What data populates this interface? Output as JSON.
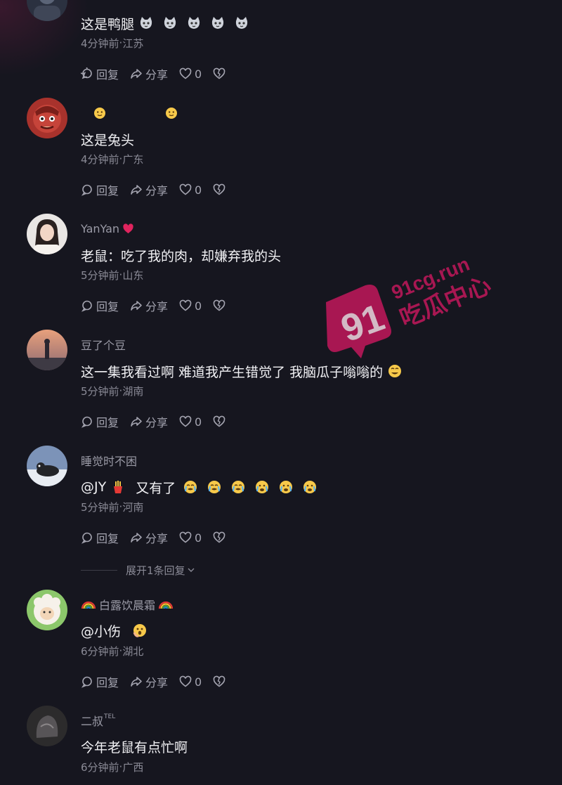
{
  "comments": [
    {
      "username": "",
      "content_text": "这是鸭腿",
      "emoji_names": [
        "cat-face-emoji",
        "cat-face-emoji",
        "cat-face-emoji",
        "cat-face-emoji",
        "cat-face-emoji"
      ],
      "time": "4分钟前",
      "location": "江苏",
      "reply_label": "回复",
      "share_label": "分享",
      "like_count": "0"
    },
    {
      "username": "",
      "content_text": "这是兔头",
      "emoji_names": [
        "slight-smile-emoji",
        "slight-smile-emoji"
      ],
      "time": "4分钟前",
      "location": "广东",
      "reply_label": "回复",
      "share_label": "分享",
      "like_count": "0"
    },
    {
      "username": "YanYan",
      "username_badge": "heart-icon",
      "content_text": "老鼠：吃了我的肉，却嫌弃我的头",
      "time": "5分钟前",
      "location": "山东",
      "reply_label": "回复",
      "share_label": "分享",
      "like_count": "0"
    },
    {
      "username": "豆了个豆",
      "content_text": "这一集我看过啊 难道我产生错觉了 我脑瓜子嗡嗡的",
      "emoji_names": [
        "dizzy-face-emoji"
      ],
      "time": "5分钟前",
      "location": "湖南",
      "reply_label": "回复",
      "share_label": "分享",
      "like_count": "0"
    },
    {
      "username": "睡觉时不困",
      "content_text": "@JY",
      "content_text_2": "又有了",
      "emoji_names": [
        "fries-emoji",
        "crying-emoji",
        "crying-emoji",
        "crying-emoji",
        "crying-emoji",
        "crying-emoji",
        "crying-emoji"
      ],
      "time": "5分钟前",
      "location": "河南",
      "reply_label": "回复",
      "share_label": "分享",
      "like_count": "0"
    },
    {
      "username": "白露饮晨霜",
      "username_badge": "rainbow-emoji",
      "content_text": "@小伤",
      "emoji_names": [
        "shocked-face-emoji"
      ],
      "time": "6分钟前",
      "location": "湖北",
      "reply_label": "回复",
      "share_label": "分享",
      "like_count": "0"
    },
    {
      "username": "二叔",
      "username_badge": "TEL",
      "content_text": "今年老鼠有点忙啊",
      "time": "6分钟前",
      "location": "广西"
    }
  ],
  "expand_replies_label": "展开1条回复",
  "watermark": {
    "logo_number": "91",
    "domain_text": "91cg.run",
    "site_name": "吃瓜中心",
    "color": "#c2185b"
  },
  "colors": {
    "background": "#16161f",
    "heart": "#e0245e",
    "muted_text": "#8a8a96"
  }
}
